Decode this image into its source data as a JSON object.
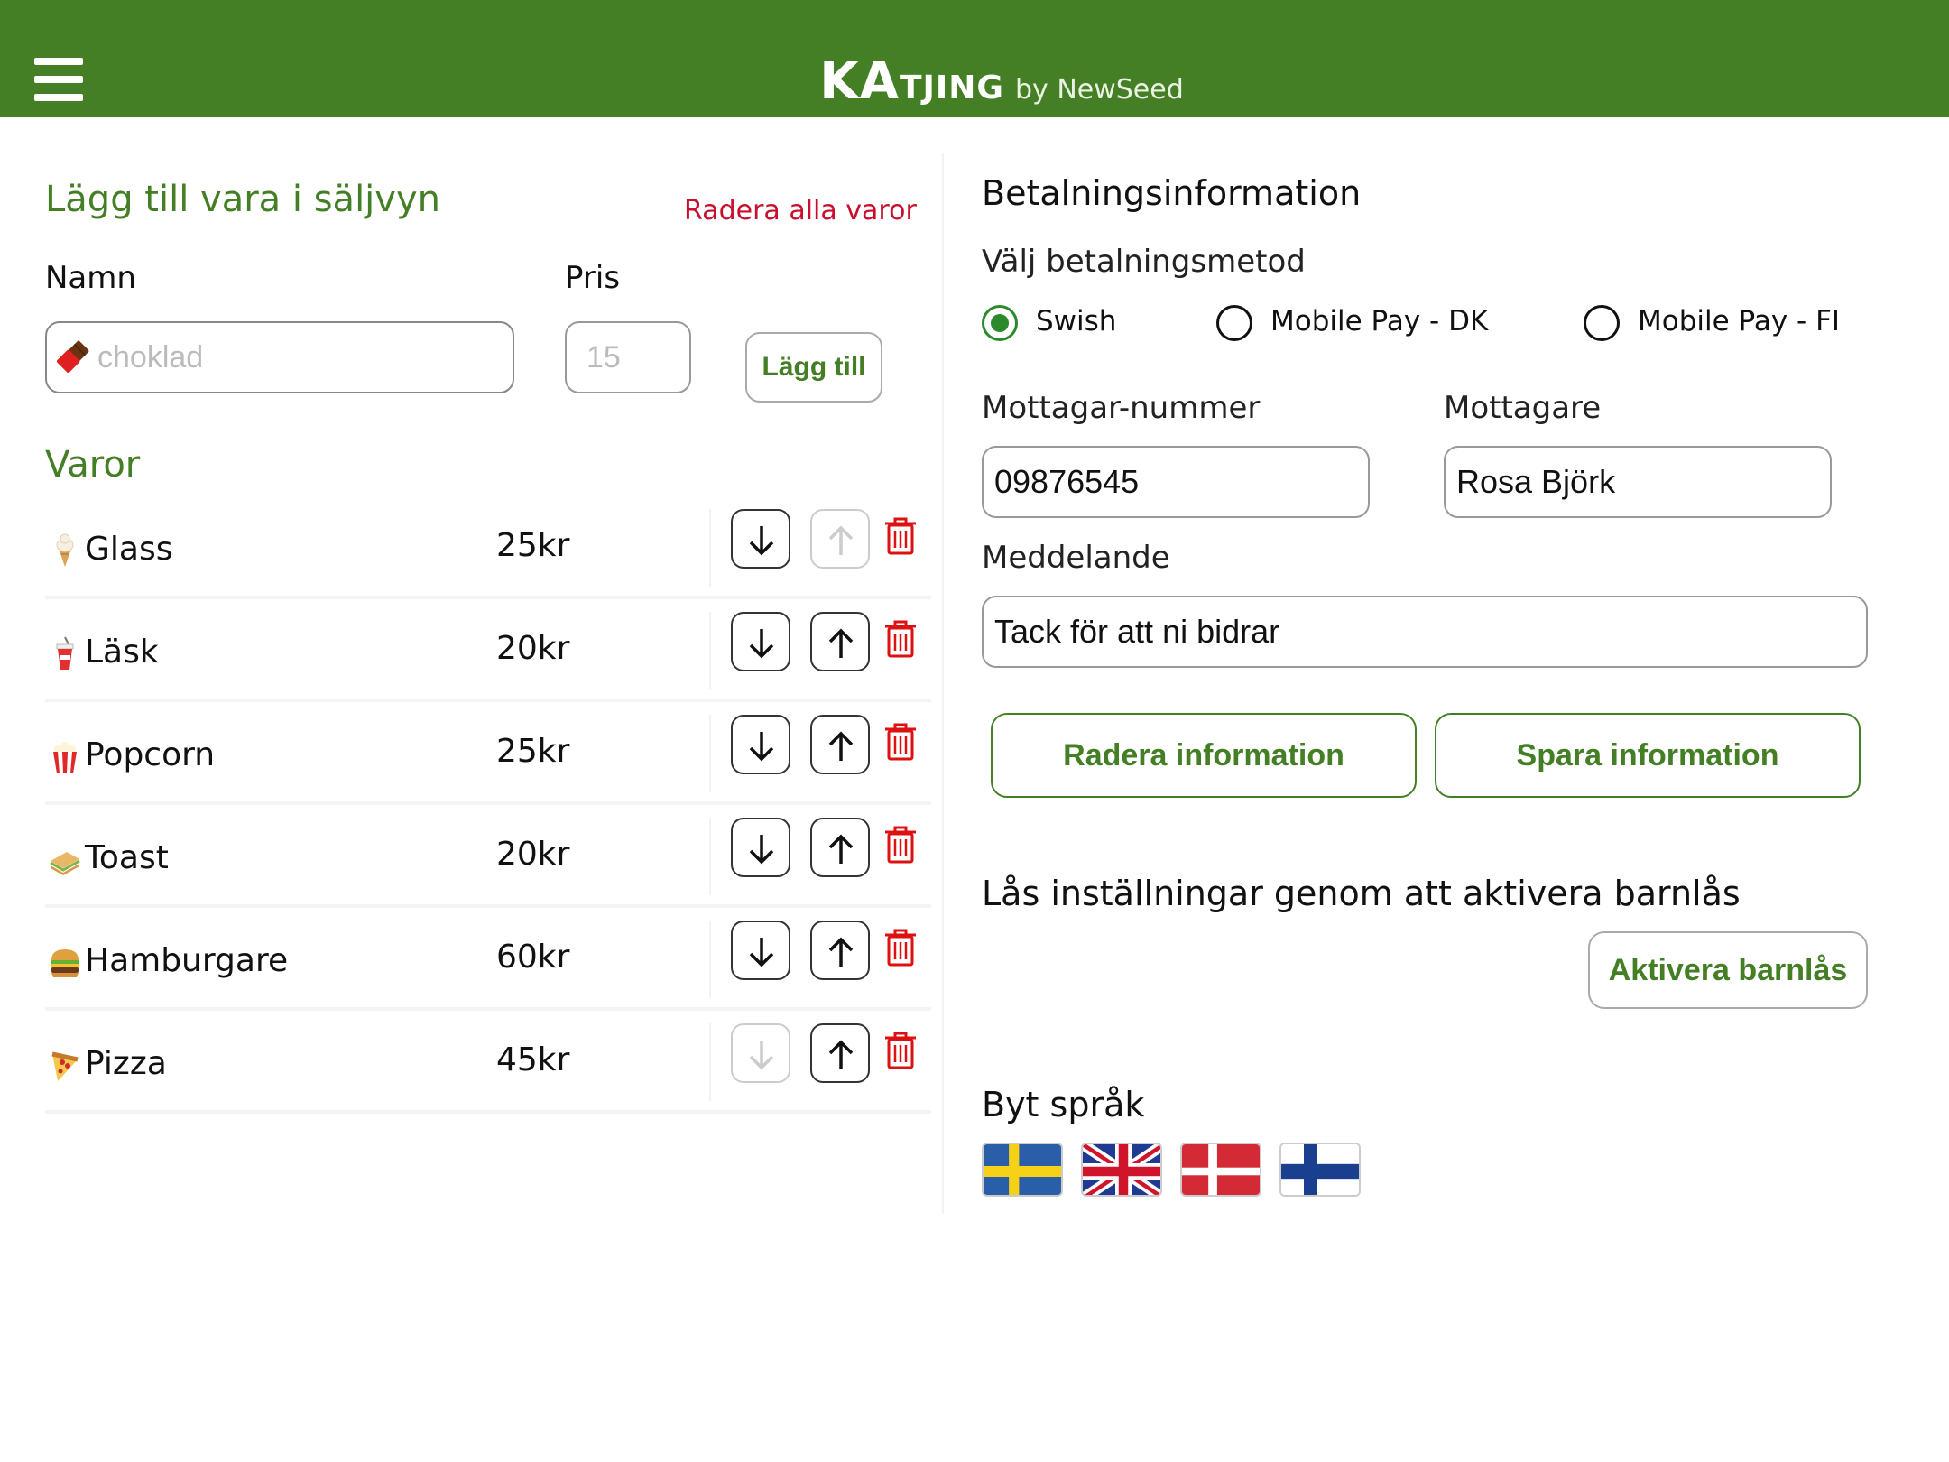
{
  "header": {
    "menu_icon": "hamburger-menu-icon",
    "brand_ka": "KA",
    "brand_tjing": "TJING",
    "brand_by": "by NewSeed",
    "color": "#447f26"
  },
  "add_item": {
    "title": "Lägg till vara i säljvyn",
    "clear_all": "Radera alla varor",
    "name_label": "Namn",
    "price_label": "Pris",
    "name_placeholder": "choklad",
    "price_placeholder": "15",
    "add_button": "Lägg till"
  },
  "items": {
    "title": "Varor",
    "list": [
      {
        "emoji": "ice-cream-icon",
        "name": "Glass",
        "price": "25kr",
        "down_enabled": true,
        "up_enabled": false
      },
      {
        "emoji": "soda-cup-icon",
        "name": "Läsk",
        "price": "20kr",
        "down_enabled": true,
        "up_enabled": true
      },
      {
        "emoji": "popcorn-icon",
        "name": "Popcorn",
        "price": "25kr",
        "down_enabled": true,
        "up_enabled": true
      },
      {
        "emoji": "sandwich-icon",
        "name": "Toast",
        "price": "20kr",
        "down_enabled": true,
        "up_enabled": true
      },
      {
        "emoji": "hamburger-icon",
        "name": "Hamburgare",
        "price": "60kr",
        "down_enabled": true,
        "up_enabled": true
      },
      {
        "emoji": "pizza-icon",
        "name": "Pizza",
        "price": "45kr",
        "down_enabled": false,
        "up_enabled": true
      }
    ]
  },
  "payment": {
    "title": "Betalningsinformation",
    "method_label": "Välj betalningsmetod",
    "methods": [
      "Swish",
      "Mobile Pay - DK",
      "Mobile Pay - FI"
    ],
    "selected_method": "Swish",
    "receiver_number_label": "Mottagar-nummer",
    "receiver_number": "09876545",
    "receiver_label": "Mottagare",
    "receiver": "Rosa Björk",
    "message_label": "Meddelande",
    "message": "Tack för att ni bidrar",
    "delete_button": "Radera information",
    "save_button": "Spara information"
  },
  "lock": {
    "text": "Lås inställningar genom att aktivera barnlås",
    "button": "Aktivera barnlås"
  },
  "language": {
    "title": "Byt språk",
    "flags": [
      "sweden-flag-icon",
      "uk-flag-icon",
      "denmark-flag-icon",
      "finland-flag-icon"
    ]
  }
}
